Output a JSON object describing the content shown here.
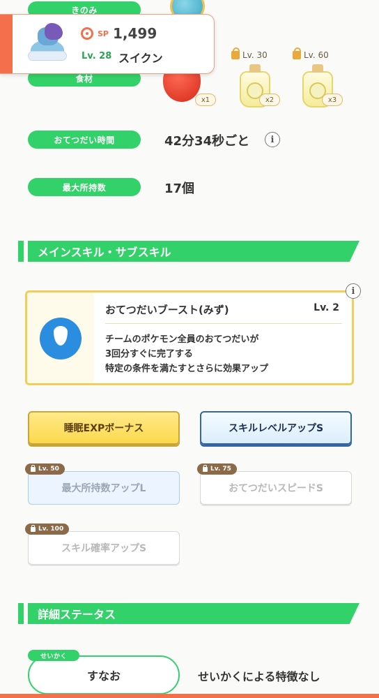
{
  "ingredients": {
    "label_top": "きのみ",
    "label_bottom": "食材",
    "slots": [
      {
        "count": "x1"
      },
      {
        "lock_level": "Lv. 30",
        "count": "x2"
      },
      {
        "lock_level": "Lv. 60",
        "count": "x3"
      }
    ]
  },
  "pokemon": {
    "sp_label": "SP",
    "strength": "1,499",
    "level": "Lv. 28",
    "name": "スイクン"
  },
  "stats": {
    "help_label": "おてつだい時間",
    "help_value": "42分34秒ごと",
    "info_glyph": "i",
    "max_label": "最大所持数",
    "max_value": "17個"
  },
  "skills_section": {
    "title": "メインスキル・サブスキル",
    "main_skill": {
      "name": "おてつだいブースト(みず)",
      "level": "Lv. 2",
      "desc_line1": "チームのポケモン全員のおてつだいが",
      "desc_line2": "3回分すぐに完了する",
      "desc_line3": "特定の条件を満たすとさらに効果アップ"
    },
    "sub_skills": [
      {
        "label": "睡眠EXPボーナス"
      },
      {
        "label": "スキルレベルアップS"
      },
      {
        "lock": "Lv. 50",
        "label": "最大所持数アップL"
      },
      {
        "lock": "Lv. 75",
        "label": "おてつだいスピードS"
      },
      {
        "lock": "Lv. 100",
        "label": "スキル確率アップS"
      }
    ]
  },
  "detail_section": {
    "title": "詳細ステータス",
    "nature_tag": "せいかく",
    "nature_value": "すなお",
    "nature_effect": "せいかくによる特徴なし"
  }
}
